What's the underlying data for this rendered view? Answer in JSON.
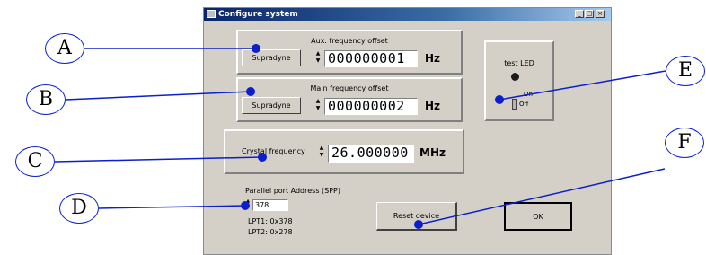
{
  "window": {
    "title": "Configure system",
    "controls": [
      "_",
      "□",
      "×"
    ]
  },
  "aux": {
    "label": "Aux. frequency offset",
    "button": "Supradyne",
    "value": "000000001",
    "unit": "Hz"
  },
  "main": {
    "label": "Main frequency offset",
    "button": "Supradyne",
    "value": "000000002",
    "unit": "Hz"
  },
  "crystal": {
    "label": "Crystal frequency",
    "value": "26.000000",
    "unit": "MHz"
  },
  "led": {
    "label": "test LED",
    "on": "On",
    "off": "Off"
  },
  "port": {
    "label": "Parallel port Address (SPP)",
    "value": "378",
    "hint1": "LPT1: 0x378",
    "hint2": "LPT2: 0x278"
  },
  "buttons": {
    "reset": "Reset device",
    "ok": "OK"
  },
  "callouts": [
    "A",
    "B",
    "C",
    "D",
    "E",
    "F"
  ],
  "colors": {
    "callout_blue": "#0b1fcc",
    "window_bg": "#d4d0c8",
    "titlebar": "#0a246a"
  }
}
